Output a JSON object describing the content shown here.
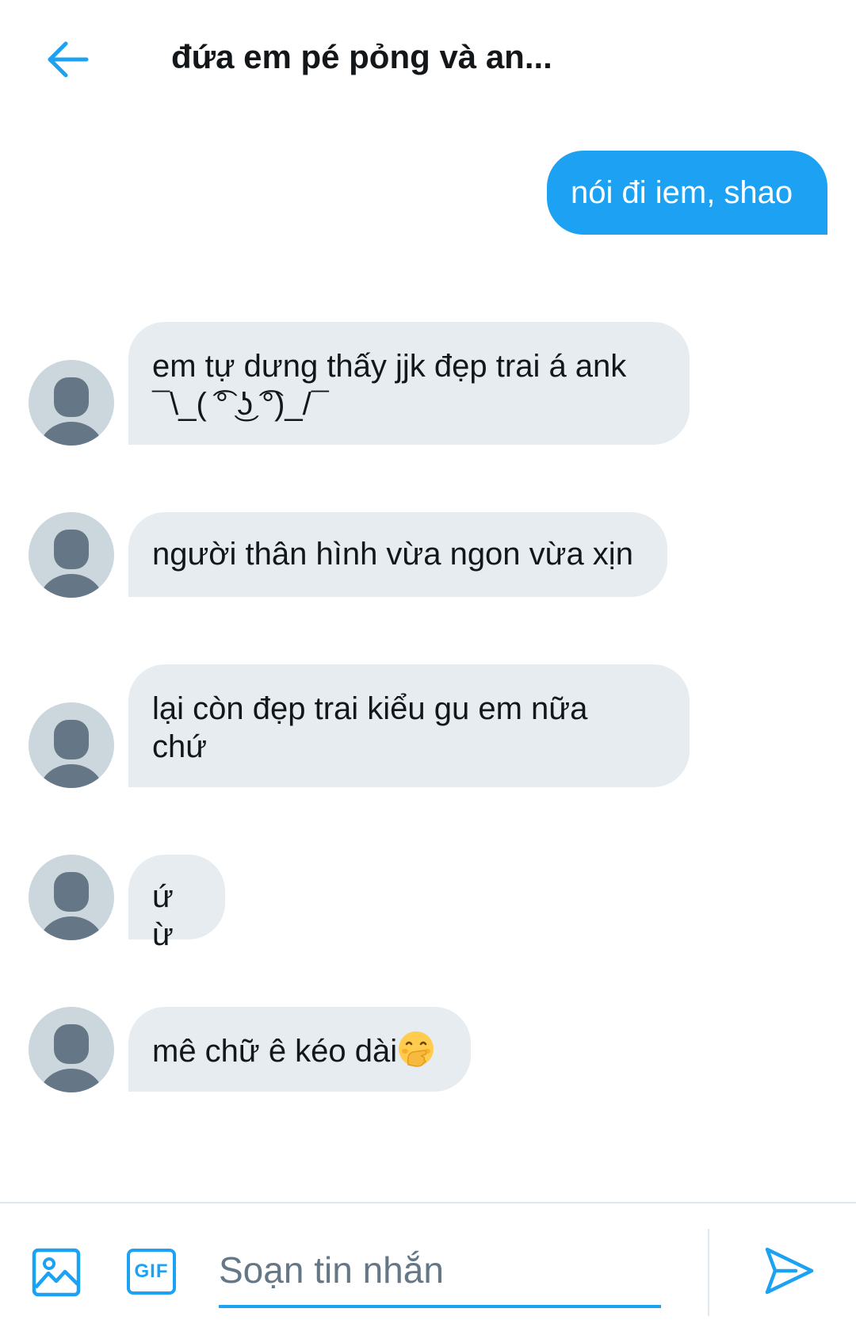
{
  "header": {
    "back_icon": "arrow-left-icon",
    "title": "đứa em pé pỏng và an..."
  },
  "colors": {
    "accent": "#1da1f2",
    "incoming_bubble": "#e6ecf0",
    "avatar_bg": "#ccd6dd",
    "avatar_fg": "#657786"
  },
  "messages": [
    {
      "direction": "outgoing",
      "text": "nói đi iem, shao"
    },
    {
      "direction": "incoming",
      "lines": [
        "em tự dưng thấy jjk đẹp trai á ank",
        "¯\\_( ͡° ͜ʖ ͡°)_/¯"
      ]
    },
    {
      "direction": "incoming",
      "text": "người thân hình vừa ngon vừa xịn"
    },
    {
      "direction": "incoming",
      "lines": [
        "lại còn đẹp trai kiểu gu em nữa",
        "chứ"
      ]
    },
    {
      "direction": "incoming",
      "text": "ứ ừ"
    },
    {
      "direction": "incoming",
      "text": "mê chữ ê kéo dài",
      "emoji": "face-with-hand-over-mouth"
    }
  ],
  "composer": {
    "image_icon": "image-icon",
    "gif_label": "GIF",
    "placeholder": "Soạn tin nhắn",
    "value": "",
    "send_icon": "send-icon"
  }
}
